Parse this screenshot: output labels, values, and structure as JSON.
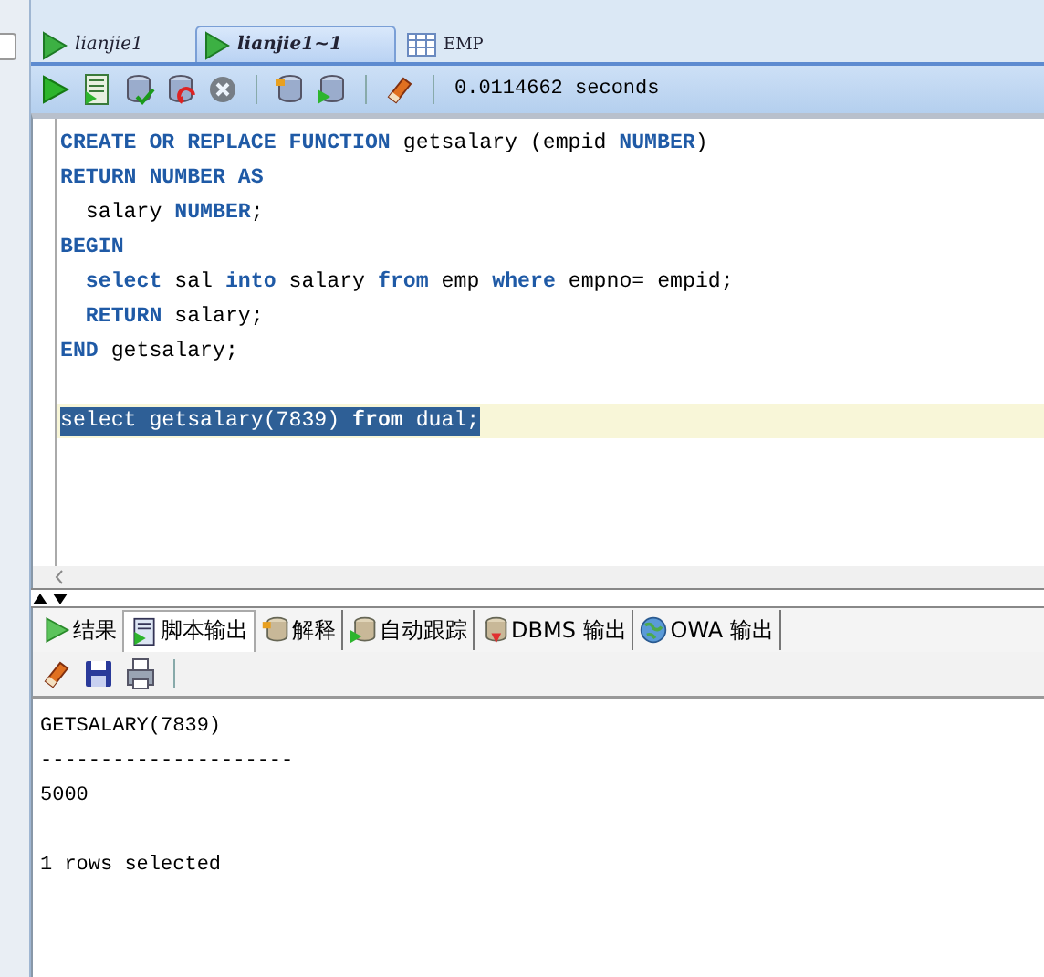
{
  "editor_tabs": [
    {
      "label": "lianjie1",
      "kind": "worksheet",
      "selected": false
    },
    {
      "label": "lianjie1~1",
      "kind": "worksheet",
      "selected": true
    },
    {
      "label": "EMP",
      "kind": "table",
      "selected": false
    }
  ],
  "toolbar": [
    {
      "kind": "run",
      "disabled": false
    },
    {
      "kind": "script",
      "disabled": false
    },
    {
      "kind": "commit",
      "disabled": false
    },
    {
      "kind": "rollback",
      "disabled": false
    },
    {
      "kind": "cancel",
      "disabled": true
    },
    {
      "kind": "sep"
    },
    {
      "kind": "db",
      "disabled": false
    },
    {
      "kind": "dbrun",
      "disabled": false
    },
    {
      "kind": "sep"
    },
    {
      "kind": "eraser",
      "disabled": false
    },
    {
      "kind": "sep"
    }
  ],
  "elapsed": "0.0114662 seconds",
  "code_lines": [
    {
      "selected": false,
      "tokens": [
        {
          "kw": true,
          "t": "CREATE OR REPLACE FUNCTION"
        },
        {
          "kw": false,
          "t": " getsalary (empid "
        },
        {
          "kw": true,
          "t": "NUMBER"
        },
        {
          "kw": false,
          "t": ")"
        }
      ]
    },
    {
      "selected": false,
      "tokens": [
        {
          "kw": true,
          "t": "RETURN NUMBER AS"
        }
      ]
    },
    {
      "selected": false,
      "tokens": [
        {
          "kw": false,
          "t": "  salary "
        },
        {
          "kw": true,
          "t": "NUMBER"
        },
        {
          "kw": false,
          "t": ";"
        }
      ]
    },
    {
      "selected": false,
      "tokens": [
        {
          "kw": true,
          "t": "BEGIN"
        }
      ]
    },
    {
      "selected": false,
      "tokens": [
        {
          "kw": true,
          "t": "  select"
        },
        {
          "kw": false,
          "t": " sal "
        },
        {
          "kw": true,
          "t": "into"
        },
        {
          "kw": false,
          "t": " salary "
        },
        {
          "kw": true,
          "t": "from"
        },
        {
          "kw": false,
          "t": " emp "
        },
        {
          "kw": true,
          "t": "where"
        },
        {
          "kw": false,
          "t": " empno= empid;"
        }
      ]
    },
    {
      "selected": false,
      "tokens": [
        {
          "kw": true,
          "t": "  RETURN"
        },
        {
          "kw": false,
          "t": " salary;"
        }
      ]
    },
    {
      "selected": false,
      "tokens": [
        {
          "kw": true,
          "t": "END"
        },
        {
          "kw": false,
          "t": " getsalary;"
        }
      ]
    },
    {
      "selected": false,
      "kind": "blank"
    },
    {
      "selected": true,
      "tokens": [
        {
          "kw": false,
          "t": "select getsalary(7839) "
        },
        {
          "kw": true,
          "t": "from"
        },
        {
          "kw": false,
          "t": " dual;"
        }
      ]
    }
  ],
  "output_tabs": [
    {
      "label": "结果",
      "kind": "run",
      "selected": false
    },
    {
      "label": "脚本输出",
      "kind": "script",
      "selected": true
    },
    {
      "label": "解释",
      "kind": "explain",
      "selected": false
    },
    {
      "label": "自动跟踪",
      "kind": "trace",
      "selected": false
    },
    {
      "label": "DBMS 输出",
      "kind": "dbms",
      "selected": false
    },
    {
      "label": "OWA 输出",
      "kind": "owa",
      "selected": false
    }
  ],
  "output_toolbar": [
    {
      "kind": "eraser"
    },
    {
      "kind": "save"
    },
    {
      "kind": "print"
    }
  ],
  "output_lines": [
    {
      "kind": "text",
      "text": "GETSALARY(7839)"
    },
    {
      "kind": "text",
      "text": "---------------------"
    },
    {
      "kind": "text",
      "text": "5000"
    },
    {
      "kind": "blank"
    },
    {
      "kind": "text",
      "text": "1 rows selected"
    }
  ]
}
